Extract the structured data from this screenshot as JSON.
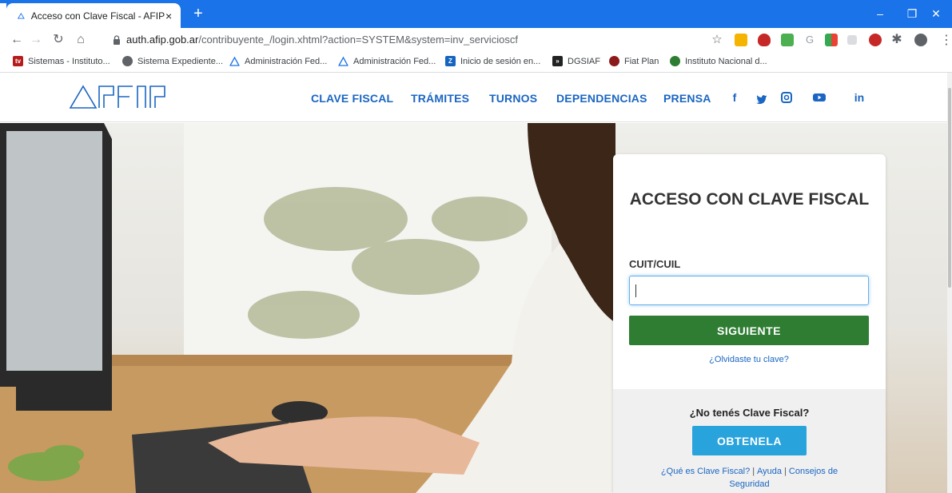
{
  "browser": {
    "tab_title": "Acceso con Clave Fiscal - AFIP",
    "tab_close": "×",
    "new_tab": "+",
    "window_controls": {
      "minimize": "–",
      "restore": "❐",
      "close": "✕"
    },
    "url_domain": "auth.afip.gob.ar",
    "url_path": "/contribuyente_/login.xhtml?action=SYSTEM&system=inv_servicioscf",
    "bookmarks": [
      {
        "label": "Sistemas - Instituto...",
        "icon": "tv-icon",
        "color": "#b71c1c"
      },
      {
        "label": "Sistema Expediente...",
        "icon": "globe-icon",
        "color": "#5f6368"
      },
      {
        "label": "Administración Fed...",
        "icon": "afip-icon",
        "color": "#1a73e8"
      },
      {
        "label": "Administración Fed...",
        "icon": "afip-icon",
        "color": "#1a73e8"
      },
      {
        "label": "Inicio de sesión en...",
        "icon": "z-icon",
        "color": "#1565c0"
      },
      {
        "label": "DGSIAF",
        "icon": "dgsiaf-icon",
        "color": "#222222"
      },
      {
        "label": "Fiat Plan",
        "icon": "fiat-icon",
        "color": "#8b1a1a"
      },
      {
        "label": "Instituto Nacional d...",
        "icon": "inti-icon",
        "color": "#2e7d32"
      }
    ]
  },
  "site": {
    "nav": [
      "CLAVE FISCAL",
      "TRÁMITES",
      "TURNOS",
      "DEPENDENCIAS",
      "PRENSA"
    ],
    "social": {
      "facebook": "f",
      "twitter": "twitter-icon",
      "instagram": "instagram-icon",
      "youtube": "youtube-icon",
      "linkedin": "in"
    },
    "brand_color": "#1a66c2"
  },
  "login": {
    "title": "ACCESO CON CLAVE FISCAL",
    "field_label": "CUIT/CUIL",
    "field_value": "",
    "next_button": "SIGUIENTE",
    "forgot_link": "¿Olvidaste tu clave?",
    "no_account": "¿No tenés Clave Fiscal?",
    "get_button": "OBTENELA",
    "what_is_link": "¿Qué es Clave Fiscal?",
    "help_link": "Ayuda",
    "security_link": "Consejos de Seguridad",
    "separator": "|",
    "colors": {
      "next": "#2e7d32",
      "get": "#29a3dc"
    }
  }
}
